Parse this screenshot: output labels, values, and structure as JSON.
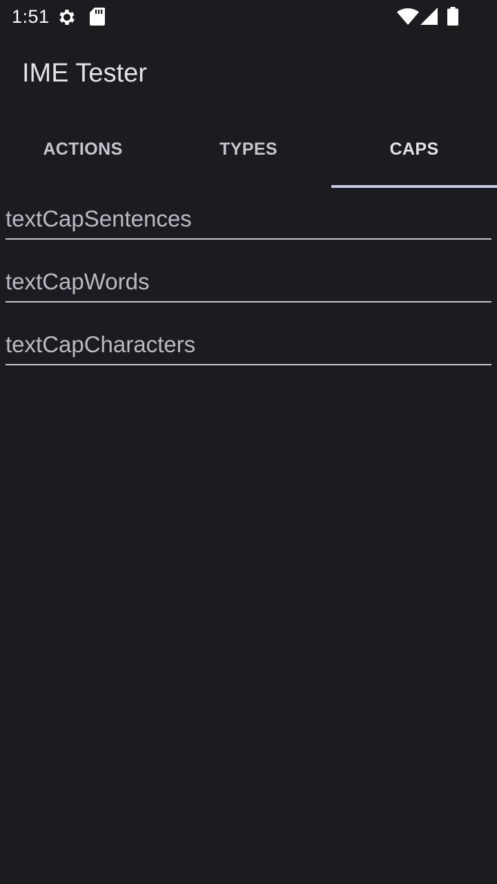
{
  "status_bar": {
    "time": "1:51",
    "icons": [
      "gear-icon",
      "sd-card-icon",
      "wifi-icon",
      "signal-icon",
      "battery-icon"
    ]
  },
  "app_bar": {
    "title": "IME Tester"
  },
  "tabs": [
    {
      "label": "ACTIONS",
      "selected": false
    },
    {
      "label": "TYPES",
      "selected": false
    },
    {
      "label": "CAPS",
      "selected": true
    }
  ],
  "fields": [
    {
      "hint": "textCapSentences",
      "value": ""
    },
    {
      "hint": "textCapWords",
      "value": ""
    },
    {
      "hint": "textCapCharacters",
      "value": ""
    }
  ],
  "colors": {
    "background": "#1c1b20",
    "tab_indicator": "#c9c8ee",
    "text_primary": "#e6e1e9",
    "hint_text": "#bdb8c4",
    "underline": "#cac4d0"
  }
}
